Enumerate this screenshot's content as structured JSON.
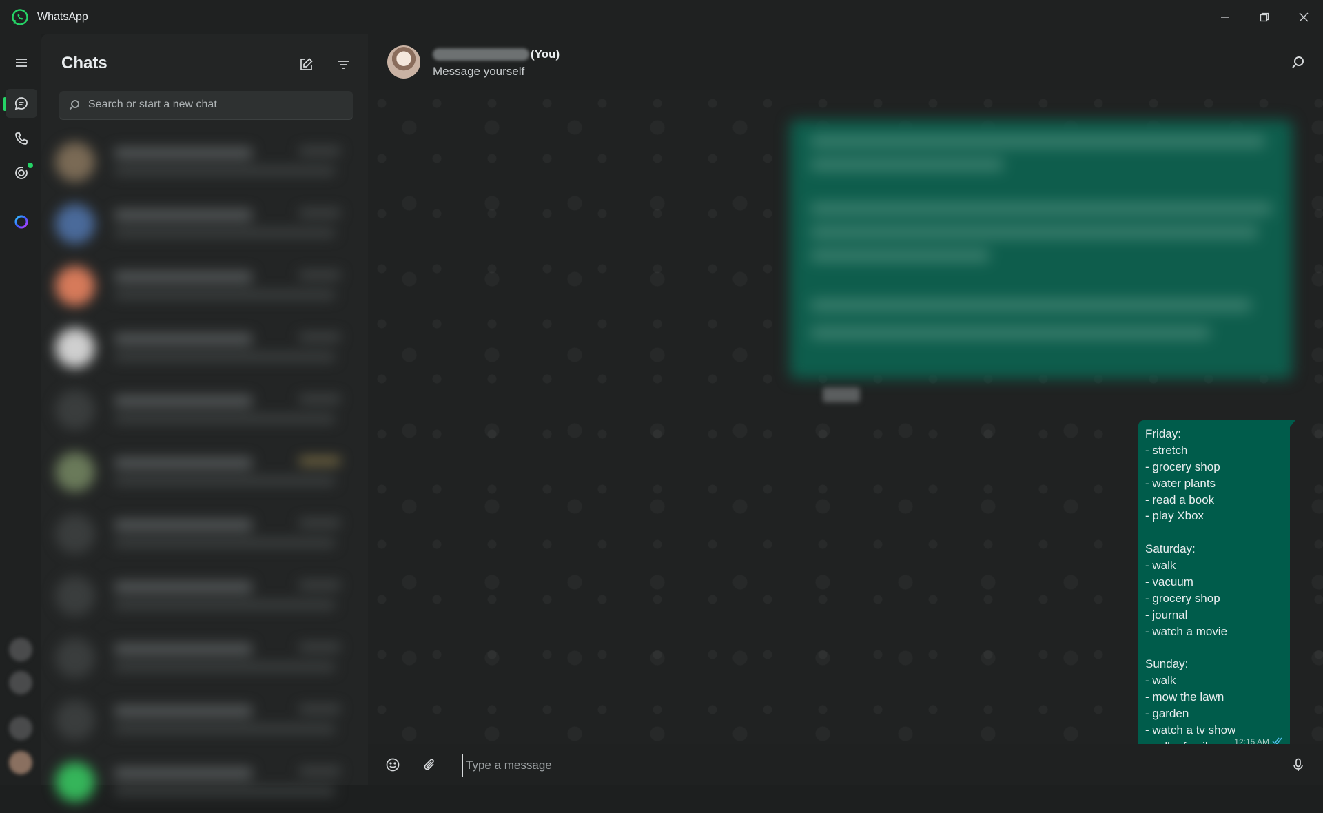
{
  "window": {
    "title": "WhatsApp",
    "logo_icon": "whatsapp-logo-icon",
    "controls": [
      "minimize-icon",
      "restore-icon",
      "close-icon"
    ]
  },
  "rail": {
    "items": [
      "menu-icon",
      "chats-icon",
      "calls-icon",
      "status-icon",
      "meta-ai-icon"
    ],
    "active": "chats",
    "accent": "#25d366"
  },
  "chat_list": {
    "title": "Chats",
    "new_chat_icon": "new-chat-icon",
    "filter_icon": "filter-icon",
    "search": {
      "placeholder": "Search or start a new chat",
      "value": ""
    },
    "row_count_visible": 10
  },
  "conversation": {
    "contact_suffix": "(You)",
    "subtitle": "Message yourself",
    "search_icon": "search-icon",
    "message": {
      "lines": [
        "Friday:",
        "- stretch",
        "- grocery shop",
        "- water plants",
        "- read a book",
        "- play Xbox",
        "",
        "Saturday:",
        "- walk",
        "- vacuum",
        "- grocery shop",
        "- journal",
        "- watch a movie",
        "",
        "Sunday:",
        "- walk",
        "- mow the lawn",
        "- garden",
        "- watch a tv show",
        "- call a family"
      ],
      "time": "12:15 AM",
      "status": "read",
      "bubble_color": "#005c4b",
      "tick_color": "#53bdeb"
    }
  },
  "composer": {
    "placeholder": "Type a message",
    "value": "",
    "icons": [
      "emoji-icon",
      "attach-icon",
      "microphone-icon"
    ]
  }
}
